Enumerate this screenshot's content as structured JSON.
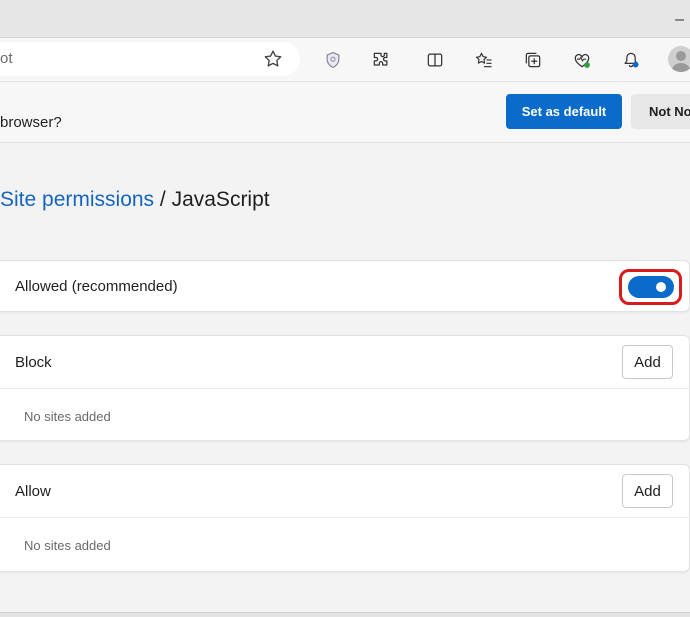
{
  "window": {
    "minimize_glyph": "–"
  },
  "toolbar": {
    "address_text": "ot",
    "icons": [
      "favorite-star-icon",
      "shield-icon",
      "extensions-icon",
      "split-screen-icon",
      "favorites-icon",
      "collections-icon",
      "browser-essentials-icon",
      "notifications-icon",
      "profile-avatar"
    ]
  },
  "banner": {
    "text": "browser?",
    "set_default_label": "Set as default",
    "not_now_label": "Not Now"
  },
  "breadcrumb": {
    "parent": "Site permissions",
    "separator": " / ",
    "current": "JavaScript"
  },
  "allowed": {
    "label": "Allowed (recommended)",
    "enabled": true
  },
  "block": {
    "label": "Block",
    "add_label": "Add",
    "empty_text": "No sites added"
  },
  "allow": {
    "label": "Allow",
    "add_label": "Add",
    "empty_text": "No sites added"
  },
  "colors": {
    "accent": "#0b6bcb",
    "highlight": "#d81b1b",
    "link": "#1565c0"
  }
}
